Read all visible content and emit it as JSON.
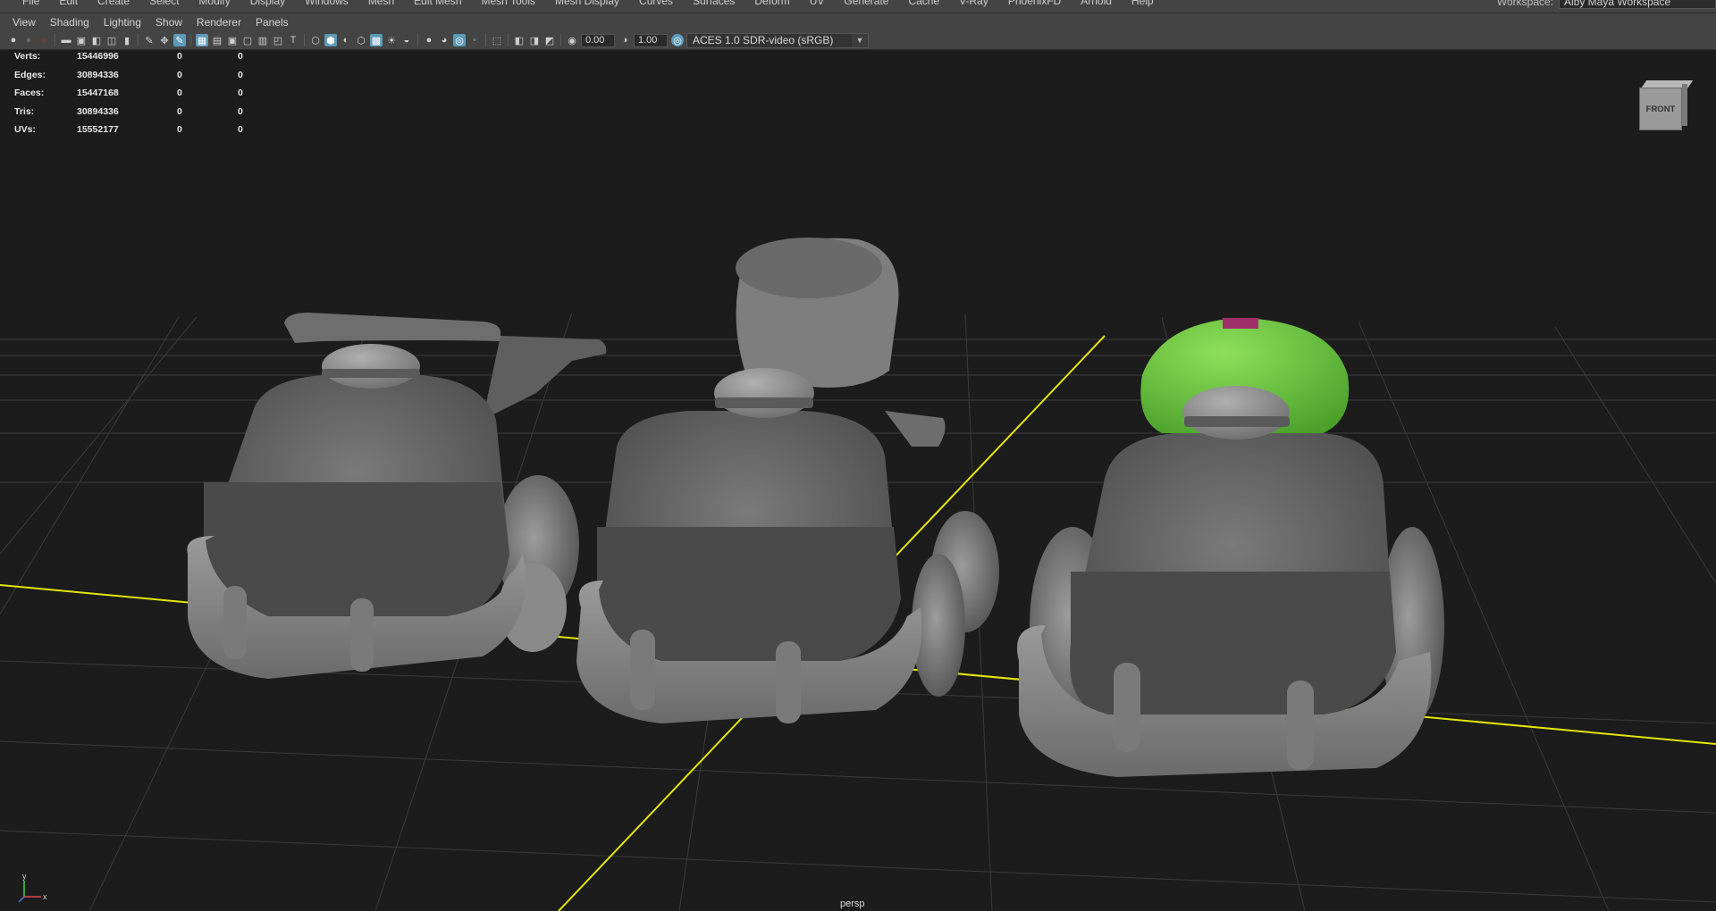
{
  "main_menu": {
    "items": [
      "File",
      "Edit",
      "Create",
      "Select",
      "Modify",
      "Display",
      "Windows",
      "Mesh",
      "Edit Mesh",
      "Mesh Tools",
      "Mesh Display",
      "Curves",
      "Surfaces",
      "Deform",
      "UV",
      "Generate",
      "Cache",
      "V-Ray",
      "PhoenixFD",
      "Arnold",
      "Help"
    ],
    "workspace_label": "Workspace:",
    "workspace_value": "Alby Maya Workspace"
  },
  "panel_menu": [
    "View",
    "Shading",
    "Lighting",
    "Show",
    "Renderer",
    "Panels"
  ],
  "toolbar": {
    "exposure": "0.00",
    "gamma": "1.00",
    "color_management": "ACES 1.0 SDR-video (sRGB)"
  },
  "hud": [
    {
      "label": "Verts:",
      "total": "15446996",
      "a": "0",
      "b": "0"
    },
    {
      "label": "Edges:",
      "total": "30894336",
      "a": "0",
      "b": "0"
    },
    {
      "label": "Faces:",
      "total": "15447168",
      "a": "0",
      "b": "0"
    },
    {
      "label": "Tris:",
      "total": "30894336",
      "a": "0",
      "b": "0"
    },
    {
      "label": "UVs:",
      "total": "15552177",
      "a": "0",
      "b": "0"
    }
  ],
  "viewcube_label": "FRONT",
  "camera_label": "persp",
  "axis_labels": {
    "x": "x",
    "y": "y"
  },
  "colors": {
    "ui_bg": "#444444",
    "viewport_bg": "#1c1c1c",
    "grid": "#3a3a3a",
    "axis_yellow": "#e6e60d",
    "model_gray": "#8a8a8a",
    "selected_green": "#6fcf3c"
  }
}
